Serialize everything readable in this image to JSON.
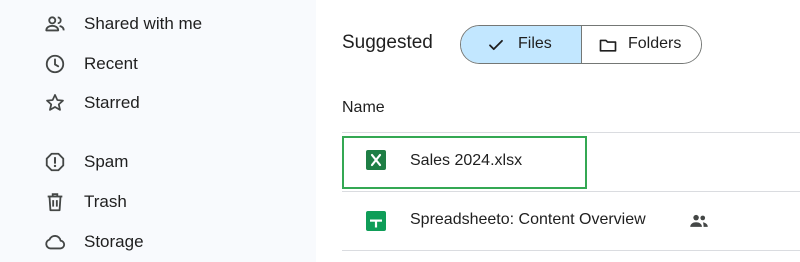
{
  "sidebar": {
    "items": [
      {
        "label": "Shared with me",
        "icon": "shared-people-icon"
      },
      {
        "label": "Recent",
        "icon": "clock-icon"
      },
      {
        "label": "Starred",
        "icon": "star-icon"
      },
      {
        "label": "Spam",
        "icon": "spam-icon"
      },
      {
        "label": "Trash",
        "icon": "trash-icon"
      },
      {
        "label": "Storage",
        "icon": "cloud-icon"
      }
    ]
  },
  "main": {
    "suggested_label": "Suggested",
    "filter": {
      "files_label": "Files",
      "folders_label": "Folders",
      "selected": "Files"
    },
    "column_header": "Name",
    "files": [
      {
        "name": "Sales 2024.xlsx",
        "icon": "excel-icon",
        "highlighted": true
      },
      {
        "name": "Spreadsheeto: Content Overview",
        "icon": "google-sheets-icon",
        "shared": true
      }
    ]
  },
  "colors": {
    "sidebar_bg": "#f8fafd",
    "selected_chip": "#c2e7ff",
    "excel_green": "#1e7e45",
    "sheets_green": "#0f9d58",
    "highlight_border": "#34a853"
  }
}
